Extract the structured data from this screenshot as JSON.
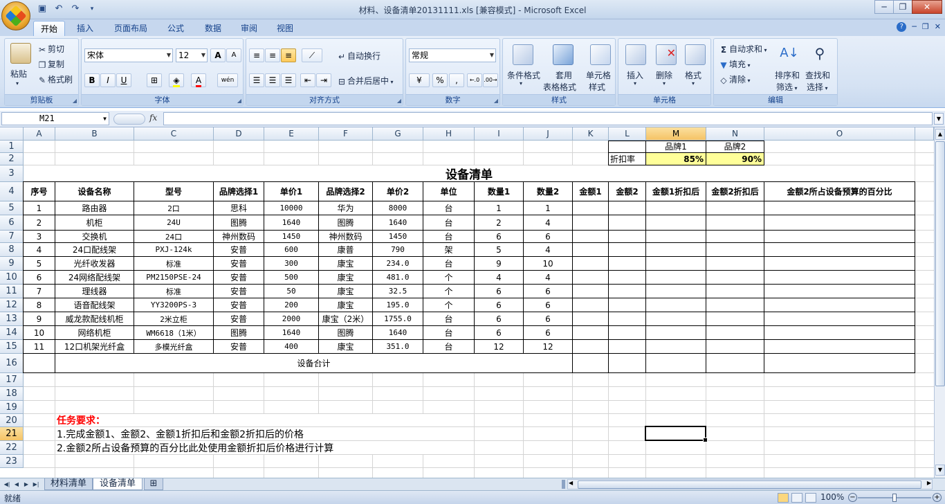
{
  "window": {
    "title": "材料、设备清单20131111.xls  [兼容模式] - Microsoft Excel",
    "controls": {
      "minimize": "─",
      "maximize": "❐",
      "close": "✕"
    }
  },
  "ribbon": {
    "tabs": [
      "开始",
      "插入",
      "页面布局",
      "公式",
      "数据",
      "审阅",
      "视图"
    ],
    "active_tab": "开始",
    "clipboard": {
      "paste": "粘贴",
      "cut": "剪切",
      "copy": "复制",
      "format_painter": "格式刷",
      "label": "剪贴板"
    },
    "font": {
      "name": "宋体",
      "size": "12",
      "grow": "A",
      "shrink": "A",
      "bold": "B",
      "italic": "I",
      "underline": "U",
      "label": "字体",
      "phonetic": "wén"
    },
    "alignment": {
      "wrap_text": "自动换行",
      "merge_center": "合并后居中",
      "label": "对齐方式"
    },
    "number": {
      "format": "常规",
      "percent": "%",
      "comma": ",",
      "label": "数字"
    },
    "styles": {
      "conditional": "条件格式",
      "table_format_1": "套用",
      "table_format_2": "表格格式",
      "cell_styles_1": "单元格",
      "cell_styles_2": "样式",
      "label": "样式"
    },
    "cells": {
      "insert": "插入",
      "delete": "删除",
      "format": "格式",
      "label": "单元格"
    },
    "editing": {
      "autosum": "自动求和",
      "fill": "填充",
      "clear": "清除",
      "sort_filter_1": "排序和",
      "sort_filter_2": "筛选",
      "find_select_1": "查找和",
      "find_select_2": "选择",
      "label": "编辑"
    }
  },
  "formula_bar": {
    "name_box": "M21",
    "fx": "fx",
    "formula": ""
  },
  "sheet": {
    "columns": [
      "A",
      "B",
      "C",
      "D",
      "E",
      "F",
      "G",
      "H",
      "I",
      "J",
      "K",
      "L",
      "M",
      "N",
      "O"
    ],
    "rows": [
      "1",
      "2",
      "3",
      "4",
      "5",
      "6",
      "7",
      "8",
      "9",
      "10",
      "11",
      "12",
      "13",
      "14",
      "15",
      "16",
      "17",
      "18",
      "19",
      "20",
      "21",
      "22",
      "23"
    ],
    "brand_header": [
      "品牌1",
      "品牌2"
    ],
    "discount_label": "折扣率",
    "discount_values": [
      "85%",
      "90%"
    ],
    "title": "设备清单",
    "headers": [
      "序号",
      "设备名称",
      "型号",
      "品牌选择1",
      "单价1",
      "品牌选择2",
      "单价2",
      "单位",
      "数量1",
      "数量2",
      "金额1",
      "金额2",
      "金额1折扣后",
      "金额2折扣后",
      "金额2所占设备预算的百分比"
    ],
    "data_rows": [
      [
        "1",
        "路由器",
        "2口",
        "思科",
        "10000",
        "华为",
        "8000",
        "台",
        "1",
        "1"
      ],
      [
        "2",
        "机柜",
        "24U",
        "图腾",
        "1640",
        "图腾",
        "1640",
        "台",
        "2",
        "4"
      ],
      [
        "3",
        "交换机",
        "24口",
        "神州数码",
        "1450",
        "神州数码",
        "1450",
        "台",
        "6",
        "6"
      ],
      [
        "4",
        "24口配线架",
        "PXJ-124k",
        "安普",
        "600",
        "康普",
        "790",
        "架",
        "5",
        "4"
      ],
      [
        "5",
        "光纤收发器",
        "标准",
        "安普",
        "300",
        "康宝",
        "234.0",
        "台",
        "9",
        "10"
      ],
      [
        "6",
        "24网络配线架",
        "PM2150PSE-24",
        "安普",
        "500",
        "康宝",
        "481.0",
        "个",
        "4",
        "4"
      ],
      [
        "7",
        "理线器",
        "标准",
        "安普",
        "50",
        "康宝",
        "32.5",
        "个",
        "6",
        "6"
      ],
      [
        "8",
        "语音配线架",
        "YY3200PS-3",
        "安普",
        "200",
        "康宝",
        "195.0",
        "个",
        "6",
        "6"
      ],
      [
        "9",
        "威龙款配线机柜",
        "2米立柜",
        "安普",
        "2000",
        "康宝（2米）",
        "1755.0",
        "台",
        "6",
        "6"
      ],
      [
        "10",
        "网络机柜",
        "WM6618（1米）",
        "图腾",
        "1640",
        "图腾",
        "1640",
        "台",
        "6",
        "6"
      ],
      [
        "11",
        "12口机架光纤盒",
        "多模光纤盒",
        "安普",
        "400",
        "康宝",
        "351.0",
        "台",
        "12",
        "12"
      ]
    ],
    "total_label": "设备合计",
    "task_title": "任务要求：",
    "task_lines": [
      "1.完成金额1、金额2、金额1折扣后和金额2折扣后的价格",
      "2.金额2所占设备预算的百分比此处使用金额折扣后价格进行计算"
    ],
    "selected_cell": "M21"
  },
  "sheet_tabs": [
    "材料清单",
    "设备清单"
  ],
  "active_sheet": "设备清单",
  "status": {
    "text": "就绪",
    "zoom": "100%"
  },
  "colors": {
    "accent": "#15428b",
    "highlight": "#ffff99",
    "task_title": "#ff0000"
  }
}
